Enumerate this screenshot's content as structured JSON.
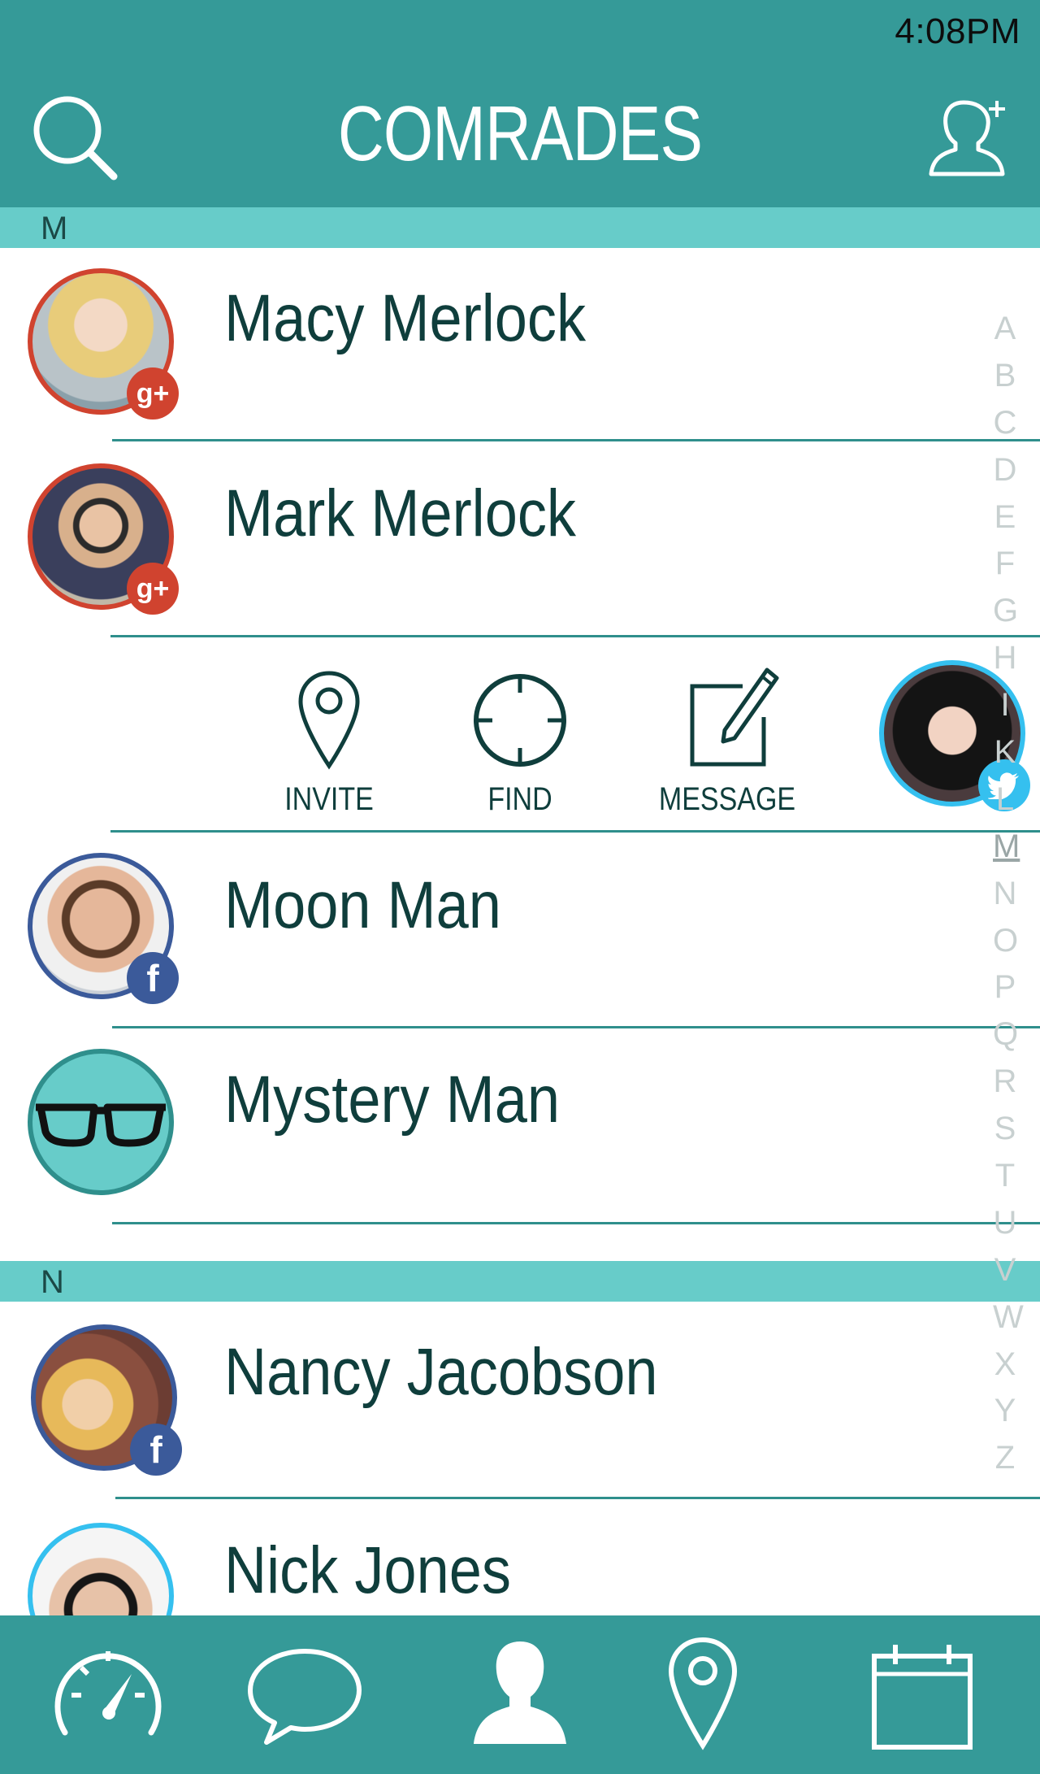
{
  "status": {
    "time": "4:08PM"
  },
  "header": {
    "title": "COMRADES",
    "search_icon": "search-icon",
    "add_icon": "add-contact-icon"
  },
  "sections": [
    {
      "letter": "M"
    },
    {
      "letter": "N"
    }
  ],
  "contacts": [
    {
      "name": "Macy Merlock",
      "network": "google-plus",
      "badge": "g+"
    },
    {
      "name": "Mark Merlock",
      "network": "google-plus",
      "badge": "g+"
    },
    {
      "name": "Moon Man",
      "network": "facebook",
      "badge": "f"
    },
    {
      "name": "Mystery Man",
      "network": "none",
      "badge": ""
    },
    {
      "name": "Nancy Jacobson",
      "network": "facebook",
      "badge": "f"
    },
    {
      "name": "Nick Jones",
      "network": "twitter",
      "badge": ""
    }
  ],
  "swiped_contact": {
    "network": "twitter"
  },
  "actions": [
    {
      "label": "INVITE",
      "icon": "location-pin-icon"
    },
    {
      "label": "FIND",
      "icon": "crosshair-icon"
    },
    {
      "label": "MESSAGE",
      "icon": "compose-icon"
    }
  ],
  "alphabet_index": [
    "A",
    "B",
    "C",
    "D",
    "E",
    "F",
    "G",
    "H",
    "I",
    "K",
    "L",
    "M",
    "N",
    "O",
    "P",
    "Q",
    "R",
    "S",
    "T",
    "U",
    "V",
    "W",
    "X",
    "Y",
    "Z"
  ],
  "alphabet_active": "M",
  "tabs": [
    {
      "icon": "dashboard-icon"
    },
    {
      "icon": "chat-icon"
    },
    {
      "icon": "contacts-icon",
      "active": true
    },
    {
      "icon": "location-pin-icon"
    },
    {
      "icon": "calendar-icon"
    }
  ],
  "colors": {
    "header": "#359a98",
    "section": "#67ccc9",
    "divider": "#2f8f8c",
    "google_plus": "#d0432f",
    "facebook": "#3b5a9a",
    "twitter": "#35c0ef"
  }
}
